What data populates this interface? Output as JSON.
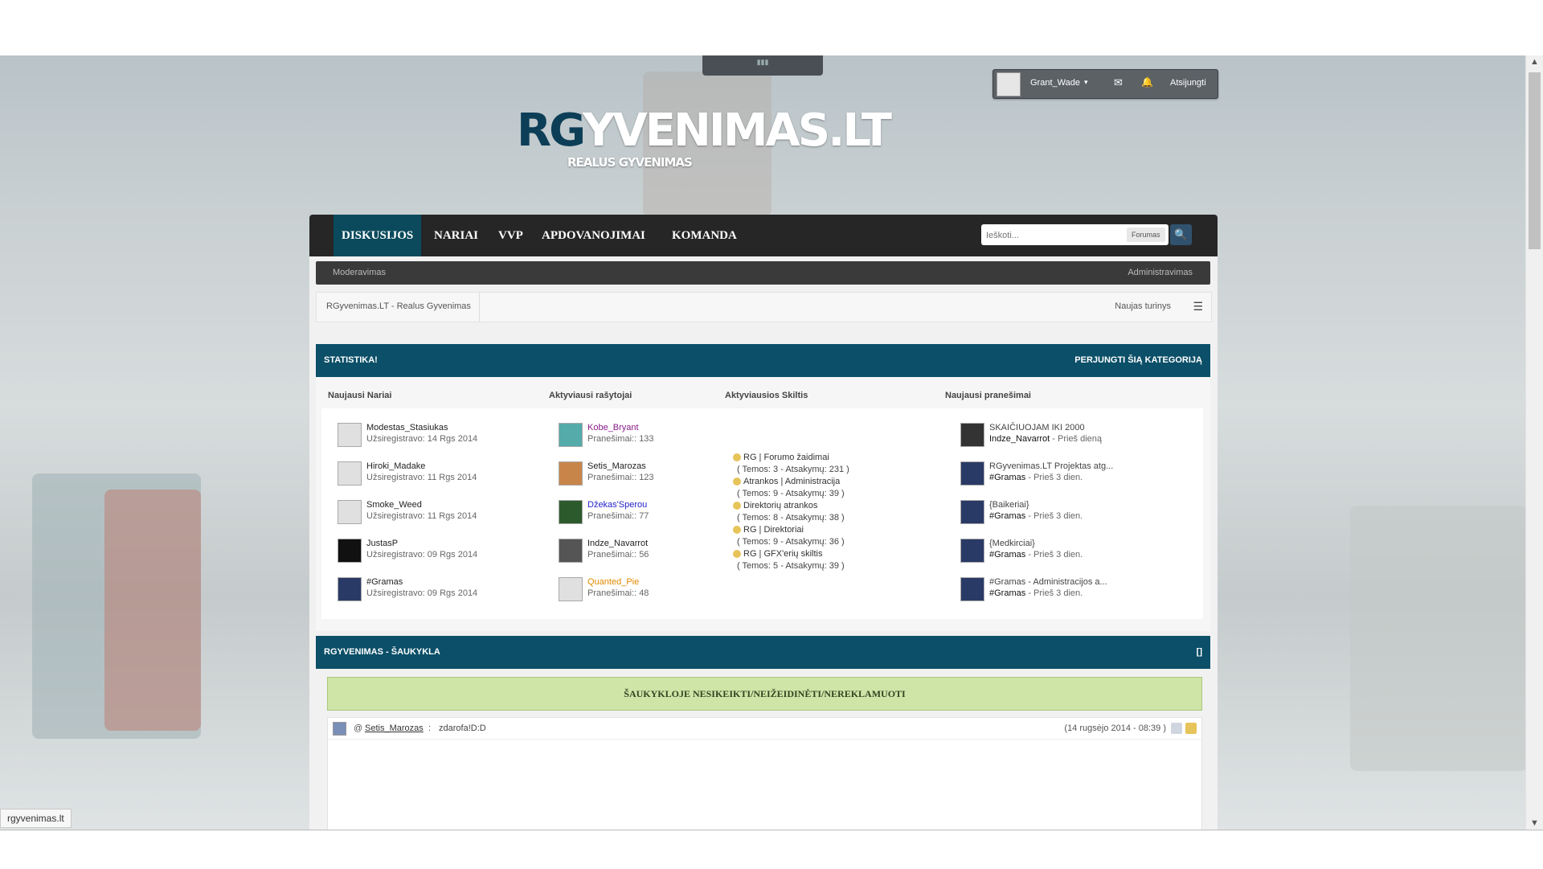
{
  "browser": {
    "status_link": "rgyvenimas.lt"
  },
  "handle_glyph": "▮▮▮",
  "userbar": {
    "username": "Grant_Wade",
    "caret": "▾",
    "mail_icon": "✉",
    "bell_icon": "🔔",
    "logout": "Atsijungti"
  },
  "logo": {
    "rg": "RG",
    "rest": "YVENIMAS.LT",
    "slogan": "REALUS GYVENIMAS"
  },
  "nav": {
    "items": [
      "DISKUSIJOS",
      "NARIAI",
      "VVP",
      "APDOVANOJIMAI",
      "KOMANDA"
    ],
    "active": "DISKUSIJOS",
    "search_placeholder": "Ieškoti...",
    "search_scope": "Forumas",
    "search_icon": "🔍"
  },
  "subnav": {
    "left": "Moderavimas",
    "right": "Administravimas"
  },
  "breadcrumb": {
    "path": "RGyvenimas.LT - Realus Gyvenimas",
    "new_content": "Naujas turinys",
    "list_icon": "☰"
  },
  "stats": {
    "title": "STATISTIKA!",
    "toggle": "PERJUNGTI ŠIĄ KATEGORIJĄ",
    "columns": {
      "newest": "Naujausi Nariai",
      "active_writers": "Aktyviausi rašytojai",
      "active_sections": "Aktyviausios Skiltis",
      "newest_posts": "Naujausi pranešimai"
    },
    "newest_members": [
      {
        "name": "Modestas_Stasiukas",
        "meta": "Užsiregistravo: 14 Rgs 2014"
      },
      {
        "name": "Hiroki_Madake",
        "meta": "Užsiregistravo: 11 Rgs 2014"
      },
      {
        "name": "Smoke_Weed",
        "meta": "Užsiregistravo: 11 Rgs 2014"
      },
      {
        "name": "JustasP",
        "meta": "Užsiregistravo: 09 Rgs 2014"
      },
      {
        "name": "#Gramas",
        "meta": "Užsiregistravo: 09 Rgs 2014"
      }
    ],
    "active_writers": [
      {
        "name": "Kobe_Bryant",
        "meta": "Pranešimai:: 133",
        "color": "#8a1a8a"
      },
      {
        "name": "Setis_Marozas",
        "meta": "Pranešimai:: 123",
        "color": "#333333"
      },
      {
        "name": "Džekas'Sperou",
        "meta": "Pranešimai:: 77",
        "color": "#2222cc"
      },
      {
        "name": "Indze_Navarrot",
        "meta": "Pranešimai:: 56",
        "color": "#222222"
      },
      {
        "name": "Quanted_Pie",
        "meta": "Pranešimai:: 48",
        "color": "#e08a00"
      }
    ],
    "active_sections": [
      {
        "name": "RG | Forumo žaidimai",
        "meta": "( Temos: 3 - Atsakymų: 231 )"
      },
      {
        "name": "Atrankos | Administracija",
        "meta": "( Temos: 9 - Atsakymų: 39 )"
      },
      {
        "name": "Direktorių atrankos",
        "meta": "( Temos: 8 - Atsakymų: 38 )"
      },
      {
        "name": "RG | Direktoriai",
        "meta": "( Temos: 9 - Atsakymų: 36 )"
      },
      {
        "name": "RG | GFX'erių skiltis",
        "meta": "( Temos: 5 - Atsakymų: 39 )"
      }
    ],
    "newest_posts": [
      {
        "title": "SKAIČIUOJAM IKI 2000",
        "author": "Indze_Navarrot",
        "when": "- Prieš dieną"
      },
      {
        "title": "RGyvenimas.LT Projektas atg...",
        "author": "#Gramas",
        "when": "- Prieš 3 dien."
      },
      {
        "title": "{Baikeriai}",
        "author": "#Gramas",
        "when": "- Prieš 3 dien."
      },
      {
        "title": "{Medkirciai}",
        "author": "#Gramas",
        "when": "- Prieš 3 dien."
      },
      {
        "title": "#Gramas - Administracijos a...",
        "author": "#Gramas",
        "when": "- Prieš 3 dien."
      }
    ]
  },
  "shoutbox": {
    "title": "RGYVENIMAS - ŠAUKYKLA",
    "toggle": "[]",
    "banner": "ŠAUKYKLOJE NESIKEIKTI/NEIŽEIDINĖTI/NEREKLAMUOTI",
    "messages": [
      {
        "at": "@",
        "user": "Setis_Marozas",
        "sep": ":",
        "text": "zdarofa!D:D",
        "time": "(14 rugsėjo 2014 - 08:39 )"
      }
    ]
  },
  "colors": {
    "accent": "#0b4f68",
    "nav_bg": "#262626",
    "banner": "#cfe5a7"
  }
}
